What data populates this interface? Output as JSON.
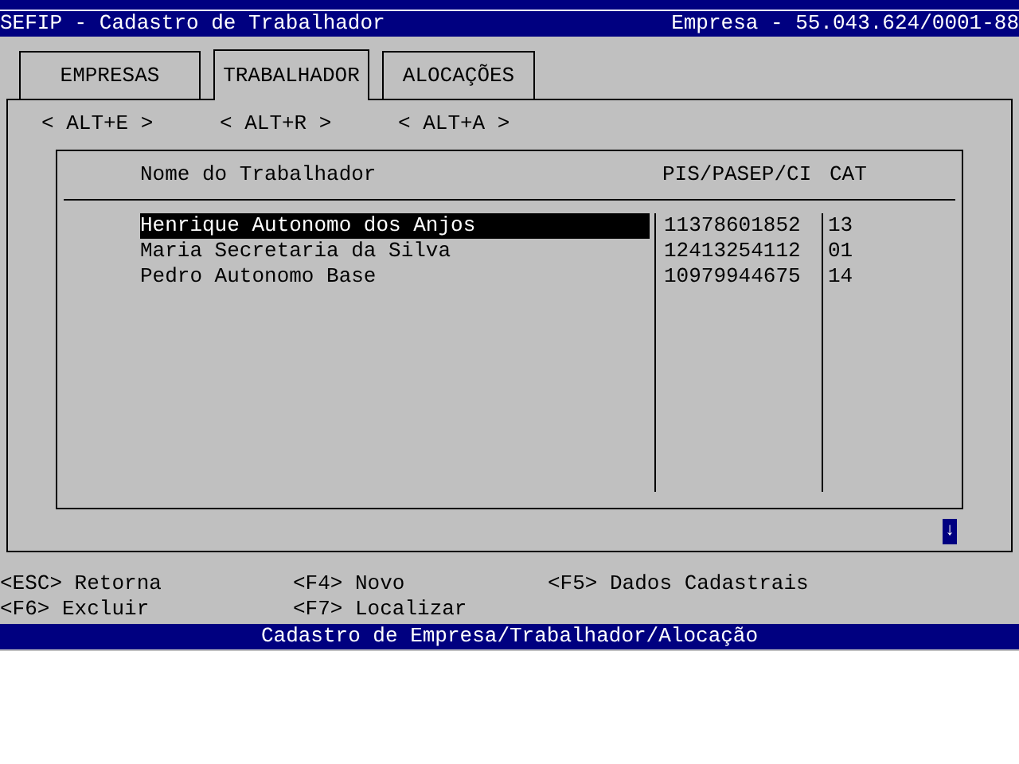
{
  "title_bar": {
    "title": "SEFIP - Cadastro de Trabalhador",
    "company": "Empresa - 55.043.624/0001-88"
  },
  "tabs": [
    {
      "label": "EMPRESAS",
      "selected": false
    },
    {
      "label": "TRABALHADOR",
      "selected": true
    },
    {
      "label": "ALOCAÇÕES",
      "selected": false
    }
  ],
  "shortcuts": [
    "< ALT+E >",
    "< ALT+R >",
    "< ALT+A >"
  ],
  "table": {
    "columns": [
      "Nome do Trabalhador",
      "PIS/PASEP/CI",
      "CAT"
    ],
    "rows": [
      {
        "name": "Henrique Autonomo dos Anjos",
        "pis": "11378601852",
        "cat": "13",
        "selected": true
      },
      {
        "name": "Maria Secretaria da Silva",
        "pis": "12413254112",
        "cat": "01",
        "selected": false
      },
      {
        "name": "Pedro Autonomo Base",
        "pis": "10979944675",
        "cat": "14",
        "selected": false
      }
    ]
  },
  "scroll_indicator": "↓",
  "keys": [
    [
      "<ESC> Retorna",
      "<F4> Novo",
      "<F5> Dados Cadastrais"
    ],
    [
      "<F6> Excluir",
      "<F7> Localizar"
    ]
  ],
  "status_bar": "Cadastro de Empresa/Trabalhador/Alocação"
}
